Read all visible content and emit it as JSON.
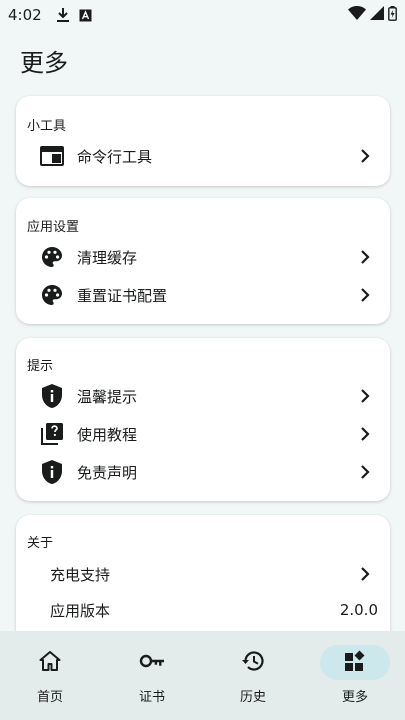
{
  "status_bar": {
    "time": "4:02",
    "left_icons": [
      "download-icon",
      "app-a-icon"
    ],
    "right_icons": [
      "wifi-icon",
      "signal-icon",
      "battery-icon"
    ]
  },
  "page": {
    "title": "更多"
  },
  "cards": {
    "tools": {
      "header": "小工具",
      "items": [
        {
          "label": "命令行工具",
          "icon": "terminal-icon"
        }
      ]
    },
    "app_settings": {
      "header": "应用设置",
      "items": [
        {
          "label": "清理缓存",
          "icon": "palette-icon"
        },
        {
          "label": "重置证书配置",
          "icon": "palette-icon"
        }
      ]
    },
    "tips": {
      "header": "提示",
      "items": [
        {
          "label": "温馨提示",
          "icon": "info-shield-icon"
        },
        {
          "label": "使用教程",
          "icon": "help-library-icon"
        },
        {
          "label": "免责声明",
          "icon": "info-shield-icon"
        }
      ]
    },
    "about": {
      "header": "关于",
      "items": [
        {
          "label": "充电支持"
        },
        {
          "label": "应用版本",
          "value": "2.0.0"
        }
      ]
    }
  },
  "bottom_nav": {
    "items": [
      {
        "label": "首页",
        "icon": "home-icon"
      },
      {
        "label": "证书",
        "icon": "key-icon"
      },
      {
        "label": "历史",
        "icon": "history-icon"
      },
      {
        "label": "更多",
        "icon": "widgets-icon",
        "active": true
      }
    ]
  },
  "colors": {
    "background": "#f1f6f6",
    "card": "#ffffff",
    "nav_bar": "#e4ebeb",
    "active_pill": "#cde8ec",
    "text": "#1a1c1c"
  }
}
